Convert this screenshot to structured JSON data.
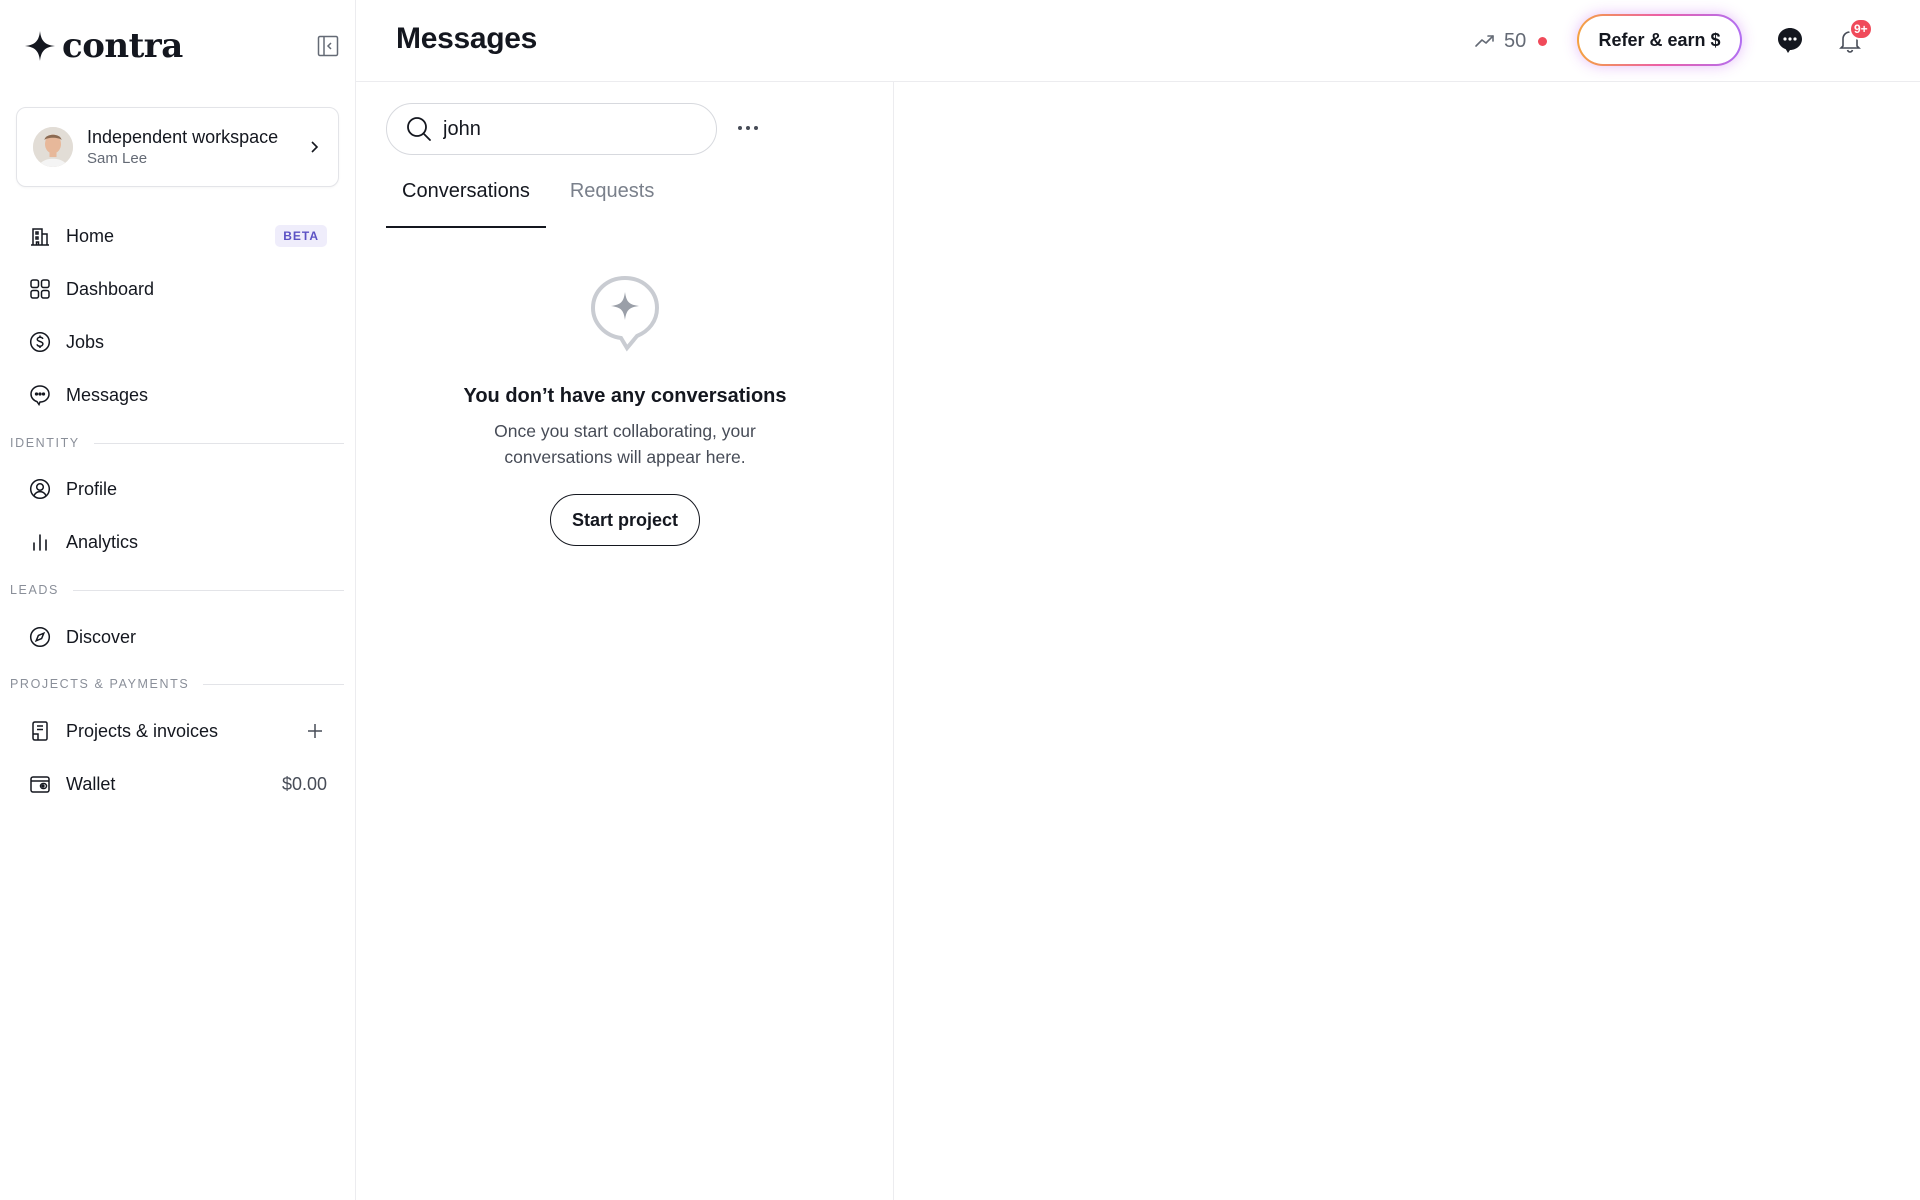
{
  "brand": {
    "name": "contra"
  },
  "workspace": {
    "title": "Independent workspace",
    "user": "Sam Lee"
  },
  "nav": {
    "home": {
      "label": "Home",
      "badge": "BETA"
    },
    "dashboard": {
      "label": "Dashboard"
    },
    "jobs": {
      "label": "Jobs"
    },
    "messages": {
      "label": "Messages"
    },
    "identity_section": "IDENTITY",
    "profile": {
      "label": "Profile"
    },
    "analytics": {
      "label": "Analytics"
    },
    "leads_section": "LEADS",
    "discover": {
      "label": "Discover"
    },
    "projects_section": "PROJECTS & PAYMENTS",
    "projects": {
      "label": "Projects & invoices"
    },
    "wallet": {
      "label": "Wallet",
      "amount": "$0.00"
    }
  },
  "header": {
    "title": "Messages",
    "streak_count": "50",
    "refer_label": "Refer & earn $",
    "notification_badge": "9+"
  },
  "conversations": {
    "search_value": "john",
    "tabs": [
      {
        "label": "Conversations",
        "active": true
      },
      {
        "label": "Requests",
        "active": false
      }
    ],
    "empty_title": "You don’t have any conversations",
    "empty_description": "Once you start collaborating, your conversations will appear here.",
    "start_label": "Start project"
  },
  "colors": {
    "accent_badge": "#5c52c4",
    "notification": "#f04a5a",
    "text_primary": "#14171f",
    "text_muted": "#646a75"
  }
}
